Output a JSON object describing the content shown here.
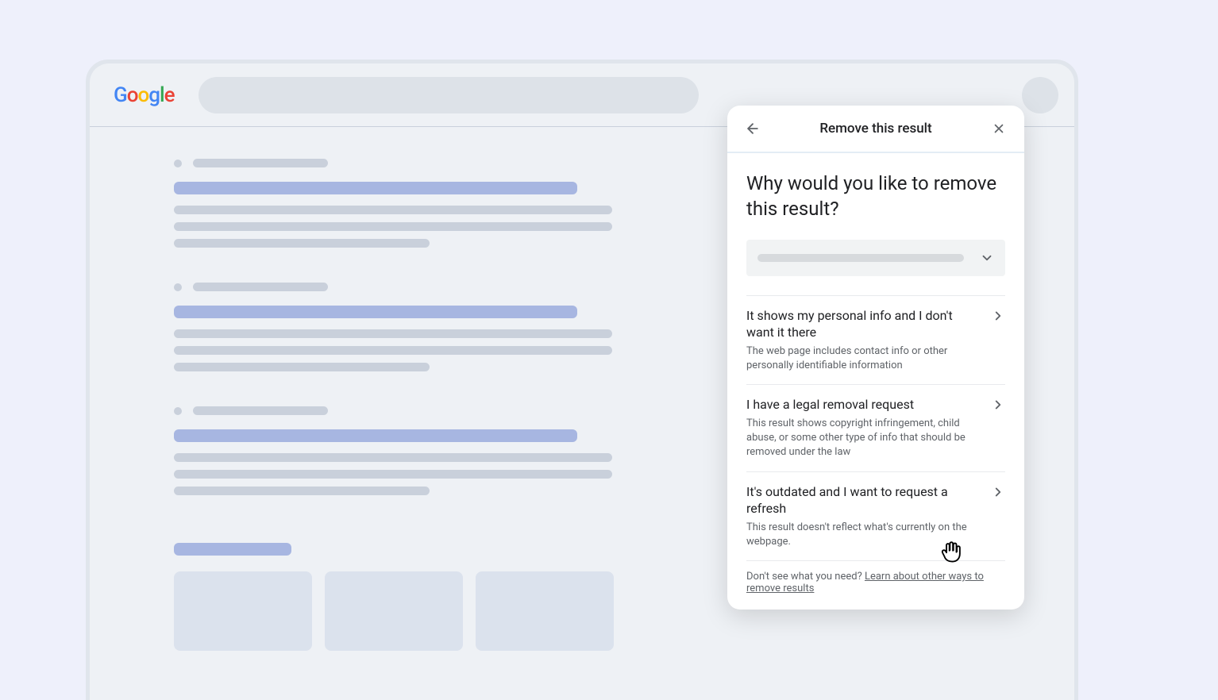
{
  "header": {
    "logo_letters": [
      "G",
      "o",
      "o",
      "g",
      "l",
      "e"
    ]
  },
  "panel": {
    "title": "Remove this result",
    "heading": "Why would you like to remove this result?",
    "options": [
      {
        "title": "It shows my personal info and I don't want it there",
        "desc": "The web page includes contact info or other personally identifiable information"
      },
      {
        "title": "I have a legal removal request",
        "desc": "This result shows copyright infringement, child abuse, or some other type of info that should be removed under the law"
      },
      {
        "title": "It's outdated and I want to request a refresh",
        "desc": "This result doesn't reflect what's currently on the webpage."
      }
    ],
    "footer_prefix": "Don't see what you need? ",
    "footer_link": "Learn about other ways to remove results"
  }
}
